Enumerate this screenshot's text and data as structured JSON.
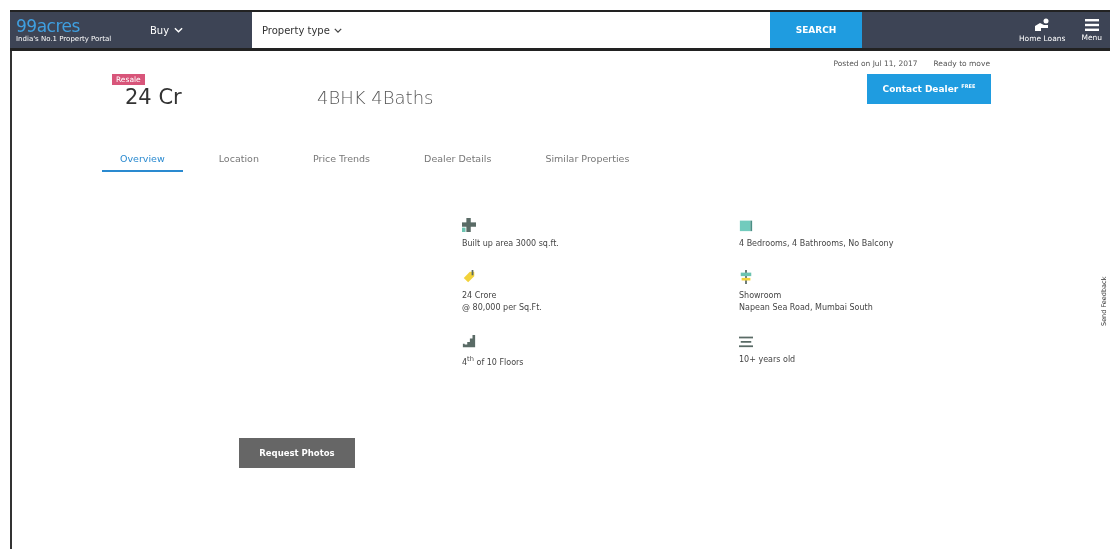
{
  "header": {
    "logo": "99acres",
    "tagline": "India's No.1 Property Portal",
    "buy_menu": "Buy",
    "property_type": "Property type",
    "search_button": "SEARCH",
    "home_loans": "Home Loans",
    "menu": "Menu"
  },
  "meta": {
    "posted": "Posted on Jul 11, 2017",
    "status": "Ready to move"
  },
  "listing": {
    "badge": "Resale",
    "price": "24 Cr",
    "config": "4BHK 4Baths",
    "contact_button": "Contact Dealer",
    "contact_tag": "FREE"
  },
  "tabs": [
    {
      "label": "Overview",
      "selected": true
    },
    {
      "label": "Location",
      "selected": false
    },
    {
      "label": "Price Trends",
      "selected": false
    },
    {
      "label": "Dealer Details",
      "selected": false
    },
    {
      "label": "Similar Properties",
      "selected": false
    }
  ],
  "details": [
    {
      "kind": "area",
      "lines": [
        "Built up area 3000 sq.ft."
      ]
    },
    {
      "kind": "rooms",
      "lines": [
        "4 Bedrooms, 4 Bathrooms, No Balcony"
      ]
    },
    {
      "kind": "price",
      "lines": [
        "24 Crore",
        "@ 80,000 per Sq.Ft."
      ]
    },
    {
      "kind": "address",
      "lines": [
        "Showroom",
        "Napean Sea Road, Mumbai South"
      ]
    },
    {
      "kind": "floor",
      "lines": [
        "4$^{th}$ of 10 Floors"
      ]
    },
    {
      "kind": "age",
      "lines": [
        "10+ years old"
      ]
    }
  ],
  "request_button": "Request Photos",
  "feedback": "Send Feedback"
}
